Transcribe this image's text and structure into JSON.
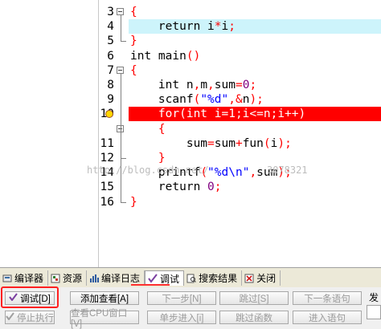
{
  "editor": {
    "lines": [
      {
        "num": "3",
        "tokens": [
          {
            "t": "{",
            "c": "br"
          }
        ],
        "fold": "box"
      },
      {
        "num": "4",
        "tokens": [
          {
            "t": "    return i",
            "c": "plain"
          },
          {
            "t": "*",
            "c": "br"
          },
          {
            "t": "i",
            "c": "plain"
          },
          {
            "t": ";",
            "c": "br"
          }
        ],
        "highlight": "blue"
      },
      {
        "num": "5",
        "tokens": [
          {
            "t": "}",
            "c": "br"
          }
        ],
        "fold": "end"
      },
      {
        "num": "6",
        "tokens": [
          {
            "t": "int main",
            "c": "plain"
          },
          {
            "t": "()",
            "c": "br"
          }
        ]
      },
      {
        "num": "7",
        "tokens": [
          {
            "t": "{",
            "c": "br"
          }
        ],
        "fold": "box"
      },
      {
        "num": "8",
        "tokens": [
          {
            "t": "    int n",
            "c": "plain"
          },
          {
            "t": ",",
            "c": "br"
          },
          {
            "t": "m",
            "c": "plain"
          },
          {
            "t": ",",
            "c": "br"
          },
          {
            "t": "sum",
            "c": "plain"
          },
          {
            "t": "=",
            "c": "br"
          },
          {
            "t": "0",
            "c": "num"
          },
          {
            "t": ";",
            "c": "br"
          }
        ]
      },
      {
        "num": "9",
        "tokens": [
          {
            "t": "    scanf",
            "c": "plain"
          },
          {
            "t": "(",
            "c": "br"
          },
          {
            "t": "\"%d\"",
            "c": "str"
          },
          {
            "t": ",&",
            "c": "br"
          },
          {
            "t": "n",
            "c": "plain"
          },
          {
            "t": ");",
            "c": "br"
          }
        ]
      },
      {
        "num": "10",
        "tokens": [
          {
            "t": "    for(int i=1;i<=n;i++)",
            "c": "plain"
          }
        ],
        "highlight": "red",
        "breakpoint": true
      },
      {
        "num": "",
        "tokens": [
          {
            "t": "    {",
            "c": "br"
          }
        ],
        "fold": "box"
      },
      {
        "num": "11",
        "tokens": [
          {
            "t": "        sum",
            "c": "plain"
          },
          {
            "t": "=",
            "c": "br"
          },
          {
            "t": "sum",
            "c": "plain"
          },
          {
            "t": "+",
            "c": "br"
          },
          {
            "t": "fun",
            "c": "plain"
          },
          {
            "t": "(",
            "c": "br"
          },
          {
            "t": "i",
            "c": "plain"
          },
          {
            "t": ");",
            "c": "br"
          }
        ]
      },
      {
        "num": "12",
        "tokens": [
          {
            "t": "    }",
            "c": "br"
          }
        ],
        "fold": "end"
      },
      {
        "num": "14",
        "tokens": [
          {
            "t": "    printf",
            "c": "plain"
          },
          {
            "t": "(",
            "c": "br"
          },
          {
            "t": "\"%d\\n\"",
            "c": "str"
          },
          {
            "t": ",",
            "c": "br"
          },
          {
            "t": "sum",
            "c": "plain"
          },
          {
            "t": ");",
            "c": "br"
          }
        ]
      },
      {
        "num": "15",
        "tokens": [
          {
            "t": "    return ",
            "c": "plain"
          },
          {
            "t": "0",
            "c": "num"
          },
          {
            "t": ";",
            "c": "br"
          }
        ]
      },
      {
        "num": "16",
        "tokens": [
          {
            "t": "}",
            "c": "br"
          }
        ],
        "fold": "end"
      }
    ],
    "watermark": "http://blog.csdn.net/          3078321"
  },
  "tabs": [
    {
      "label": "编译器",
      "icon": "compiler-icon"
    },
    {
      "label": "资源",
      "icon": "resources-icon"
    },
    {
      "label": "编译日志",
      "icon": "compile-log-icon"
    },
    {
      "label": "调试",
      "icon": "debug-check-icon",
      "active": true
    },
    {
      "label": "搜索结果",
      "icon": "search-results-icon"
    },
    {
      "label": "关闭",
      "icon": "close-icon"
    }
  ],
  "buttons": {
    "debug": "调试[D]",
    "add_watch": "添加查看[A]",
    "next_step": "下一步[N]",
    "skip": "跳过[S]",
    "next_statement": "下一条语句",
    "stop": "停止执行",
    "view_cpu": "查看CPU窗口[V]",
    "step_into": "单步进入[i]",
    "skip_function": "跳过函数",
    "enter_statement": "进入语句"
  },
  "side_label": "发",
  "colors": {
    "current_line": "#cdf4fb",
    "breakpoint_line": "#ff0000",
    "string": "#0000ff",
    "number": "#800080",
    "operator": "#ff0000"
  }
}
